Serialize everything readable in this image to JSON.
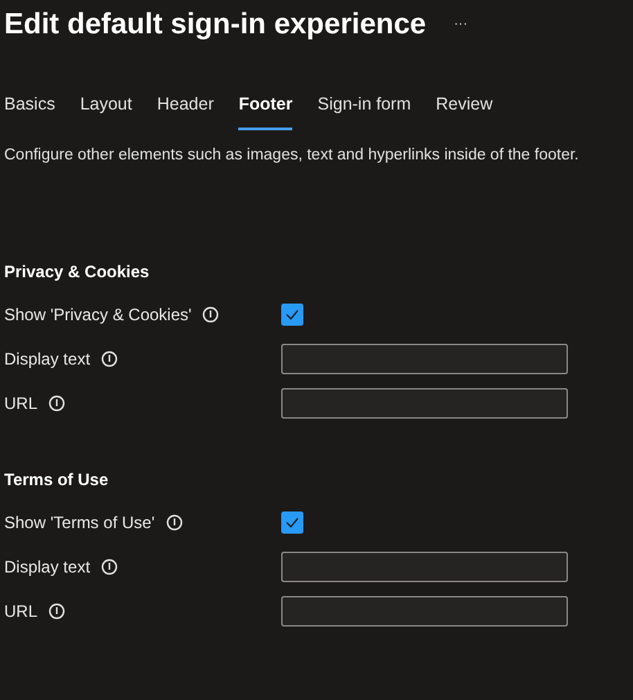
{
  "title": "Edit default sign-in experience",
  "more_button": "···",
  "tabs": [
    {
      "label": "Basics",
      "selected": false
    },
    {
      "label": "Layout",
      "selected": false
    },
    {
      "label": "Header",
      "selected": false
    },
    {
      "label": "Footer",
      "selected": true
    },
    {
      "label": "Sign-in form",
      "selected": false
    },
    {
      "label": "Review",
      "selected": false
    }
  ],
  "description": "Configure other elements such as images, text and hyperlinks inside of the footer.",
  "sections": [
    {
      "heading": "Privacy & Cookies",
      "fields": [
        {
          "kind": "checkbox",
          "label": "Show 'Privacy & Cookies'",
          "checked": true
        },
        {
          "kind": "text",
          "label": "Display text"
        },
        {
          "kind": "text",
          "label": "URL"
        }
      ]
    },
    {
      "heading": "Terms of Use",
      "fields": [
        {
          "kind": "checkbox",
          "label": "Show 'Terms of Use'",
          "checked": true
        },
        {
          "kind": "text",
          "label": "Display text"
        },
        {
          "kind": "text",
          "label": "URL"
        }
      ]
    }
  ]
}
